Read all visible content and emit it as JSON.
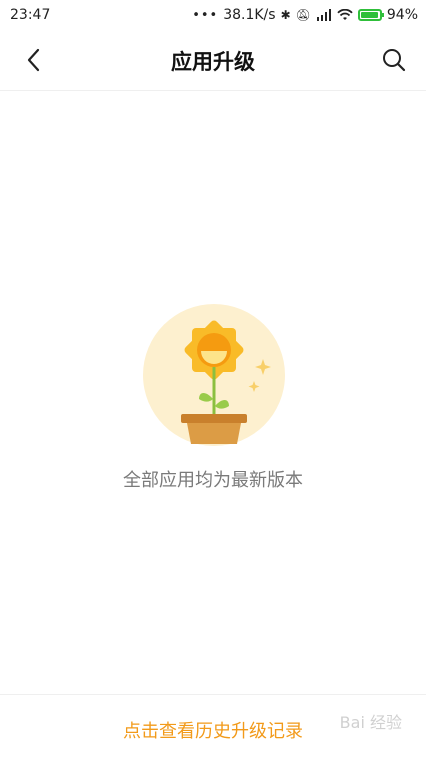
{
  "status_bar": {
    "time": "23:47",
    "net_speed": "38.1K/s",
    "battery": "94%"
  },
  "header": {
    "title": "应用升级"
  },
  "empty_state": {
    "message": "全部应用均为最新版本"
  },
  "footer": {
    "history_link": "点击查看历史升级记录",
    "watermark": "Bai 经验"
  },
  "colors": {
    "accent": "#f29a1a",
    "illustration_bg": "#fdf0cf",
    "sun": "#f9b31e",
    "pot": "#d8963e"
  }
}
